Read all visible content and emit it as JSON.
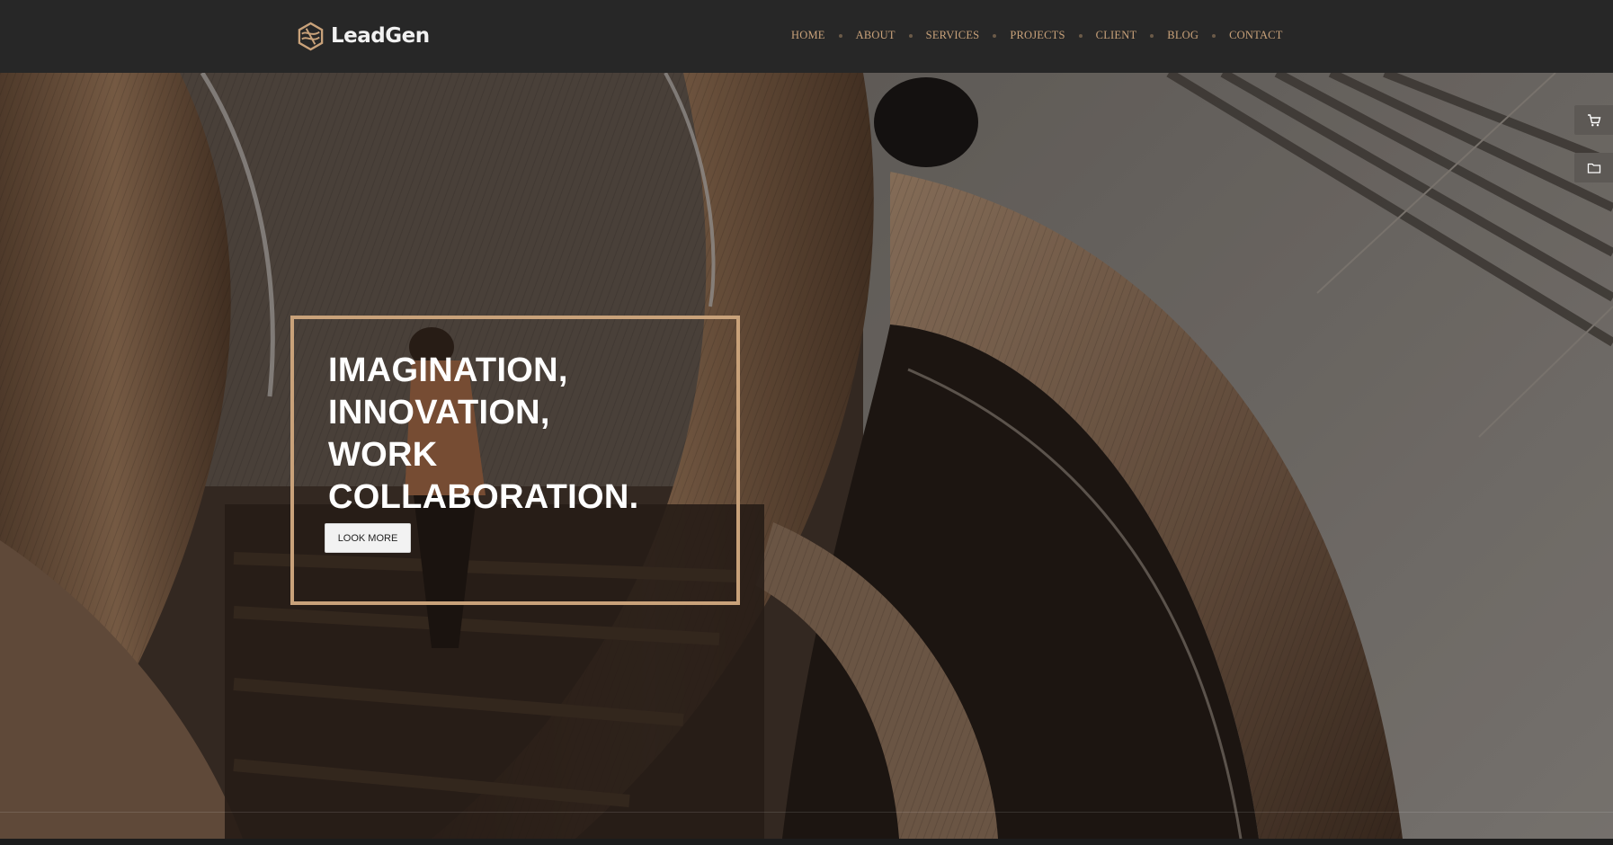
{
  "brand": {
    "name": "LeadGen",
    "accent": "#c9a27a"
  },
  "nav": {
    "items": [
      "HOME",
      "ABOUT",
      "SERVICES",
      "PROJECTS",
      "CLIENT",
      "BLOG",
      "CONTACT"
    ]
  },
  "hero": {
    "title_lines": [
      "IMAGINATION,",
      "INNOVATION,",
      "WORK",
      "COLLABORATION."
    ],
    "cta_label": "LOOK MORE"
  },
  "side_widgets": [
    {
      "icon": "cart-icon"
    },
    {
      "icon": "folder-icon"
    }
  ]
}
